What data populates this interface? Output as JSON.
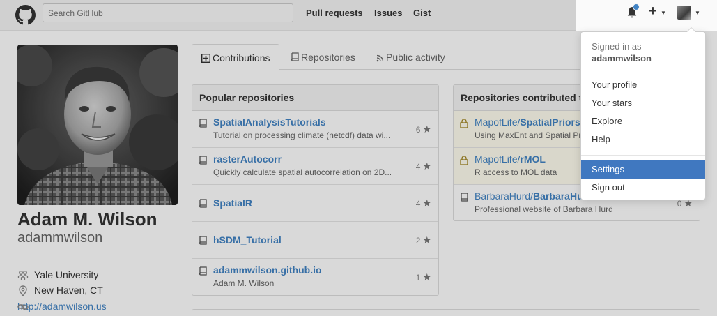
{
  "header": {
    "search_placeholder": "Search GitHub",
    "nav": [
      "Pull requests",
      "Issues",
      "Gist"
    ]
  },
  "profile": {
    "full_name": "Adam M. Wilson",
    "username": "adammwilson",
    "organization": "Yale University",
    "location": "New Haven, CT",
    "website": "http://adamwilson.us"
  },
  "tabs": {
    "contributions": "Contributions",
    "repositories": "Repositories",
    "public_activity": "Public activity"
  },
  "popular": {
    "title": "Popular repositories",
    "repos": [
      {
        "name": "SpatialAnalysisTutorials",
        "desc": "Tutorial on processing climate (netcdf) data wi...",
        "stars": "6"
      },
      {
        "name": "rasterAutocorr",
        "desc": "Quickly calculate spatial autocorrelation on 2D...",
        "stars": "4"
      },
      {
        "name": "SpatialR",
        "desc": "",
        "stars": "4"
      },
      {
        "name": "hSDM_Tutorial",
        "desc": "",
        "stars": "2"
      },
      {
        "name": "adammwilson.github.io",
        "desc": "Adam M. Wilson",
        "stars": "1"
      }
    ]
  },
  "contributed": {
    "title": "Repositories contributed t",
    "repos": [
      {
        "owner": "MapofLife/",
        "name": "SpatialPriors",
        "desc": "Using MaxEnt and Spatial Pr",
        "stars": ""
      },
      {
        "owner": "MapofLife/",
        "name": "rMOL",
        "desc": "R access to MOL data",
        "stars": ""
      },
      {
        "owner": "BarbaraHurd/",
        "name": "BarbaraHu",
        "desc": "Professional website of Barbara Hurd",
        "stars": "0"
      }
    ]
  },
  "dropdown": {
    "signed_in_as": "Signed in as",
    "user": "adammwilson",
    "items": [
      "Your profile",
      "Your stars",
      "Explore",
      "Help"
    ],
    "settings": "Settings",
    "sign_out": "Sign out"
  },
  "colors": {
    "link": "#4183c4",
    "active_item": "#4078c0",
    "notification_dot": "#4183c4"
  },
  "icons": [
    "github-logo-icon",
    "bell-icon",
    "plus-icon",
    "repo-icon",
    "lock-icon",
    "star-icon",
    "organization-icon",
    "location-icon",
    "link-icon",
    "book-icon",
    "rss-icon"
  ]
}
